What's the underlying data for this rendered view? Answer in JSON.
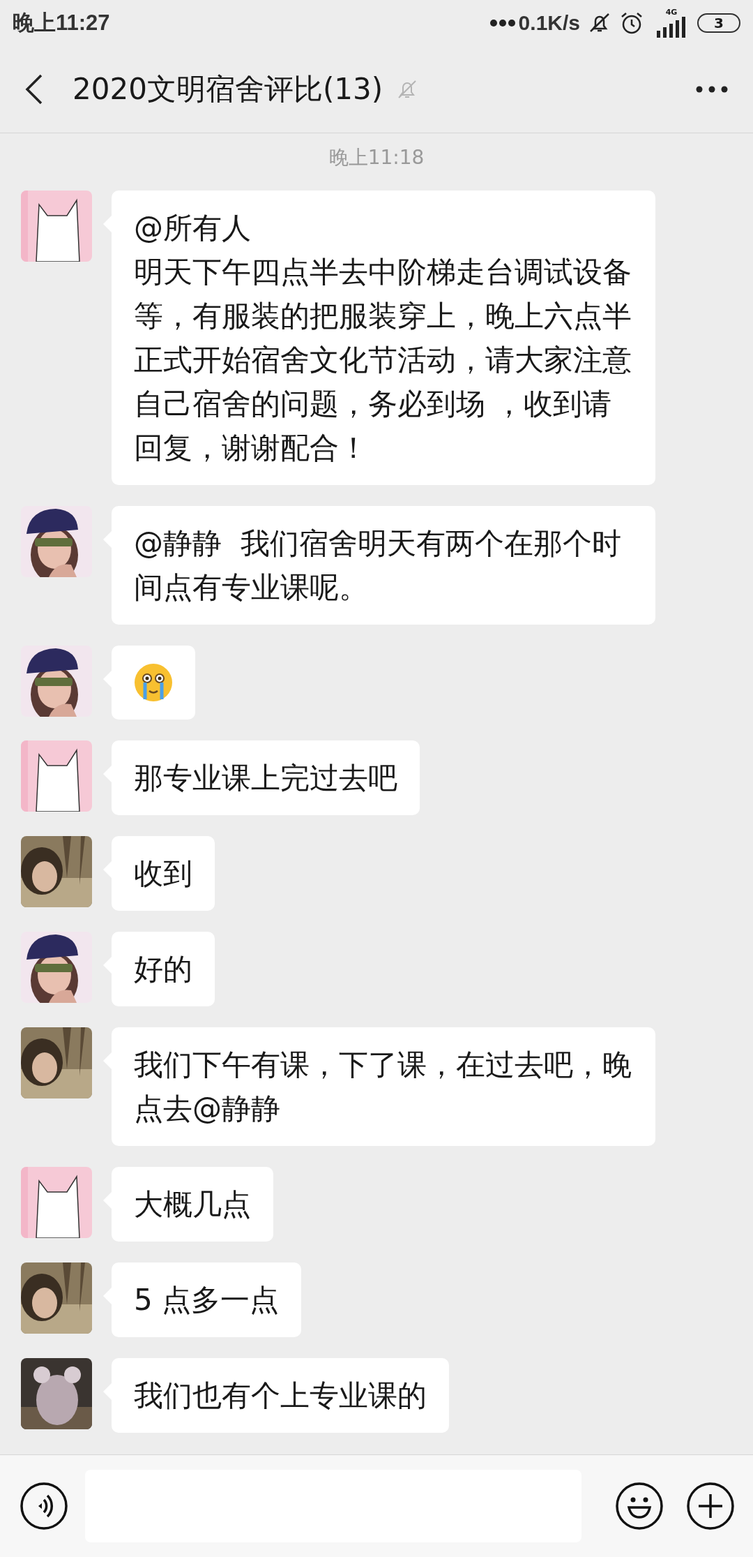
{
  "status_bar": {
    "time": "晚上11:27",
    "speed": "0.1K/s",
    "network": "4G",
    "battery": "3"
  },
  "header": {
    "title": "2020文明宿舍评比(13)",
    "muted": true
  },
  "timestamp": "晚上11:18",
  "messages": [
    {
      "avatar": {
        "kind": "cat"
      },
      "kind": "text",
      "mention": "@所有人",
      "text": "明天下午四点半去中阶梯走台调试设备等，有服装的把服装穿上，晚上六点半正式开始宿舍文化节活动，请大家注意自己宿舍的问题，务必到场 ，收到请回复，谢谢配合！"
    },
    {
      "avatar": {
        "kind": "hat"
      },
      "kind": "text",
      "text": "@静静  我们宿舍明天有两个在那个时间点有专业课呢。"
    },
    {
      "avatar": {
        "kind": "hat"
      },
      "kind": "emoji"
    },
    {
      "avatar": {
        "kind": "cat"
      },
      "kind": "text",
      "text": "那专业课上完过去吧"
    },
    {
      "avatar": {
        "kind": "outdoor"
      },
      "kind": "text",
      "text": "收到"
    },
    {
      "avatar": {
        "kind": "hat"
      },
      "kind": "text",
      "text": "好的"
    },
    {
      "avatar": {
        "kind": "outdoor"
      },
      "kind": "text",
      "text": "我们下午有课，下了课，在过去吧，晚点去@静静"
    },
    {
      "avatar": {
        "kind": "cat"
      },
      "kind": "text",
      "text": "大概几点"
    },
    {
      "avatar": {
        "kind": "outdoor"
      },
      "kind": "text",
      "text": "5 点多一点"
    },
    {
      "avatar": {
        "kind": "plush"
      },
      "kind": "text",
      "text": "我们也有个上专业课的"
    }
  ]
}
